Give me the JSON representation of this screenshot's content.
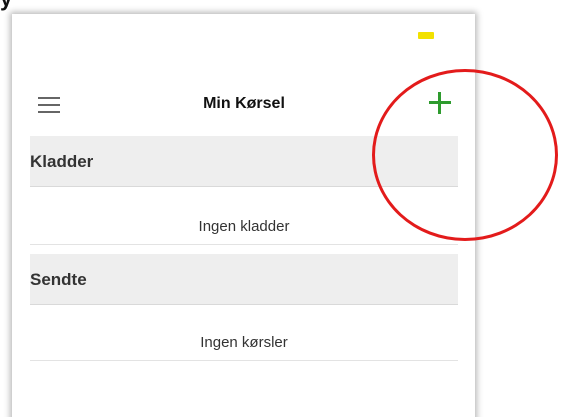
{
  "caption": {
    "fragment": "y"
  },
  "header": {
    "title": "Min Kørsel",
    "menu_icon": "hamburger-menu-icon",
    "add_icon": "plus-icon"
  },
  "sections": [
    {
      "title": "Kladder",
      "empty_text": "Ingen kladder"
    },
    {
      "title": "Sendte",
      "empty_text": "Ingen kørsler"
    }
  ],
  "colors": {
    "add_icon": "#2e9b2e",
    "status_indicator": "#f2e100",
    "annotation_ring": "#e31b1b",
    "section_header_bg": "#eeeeee"
  }
}
